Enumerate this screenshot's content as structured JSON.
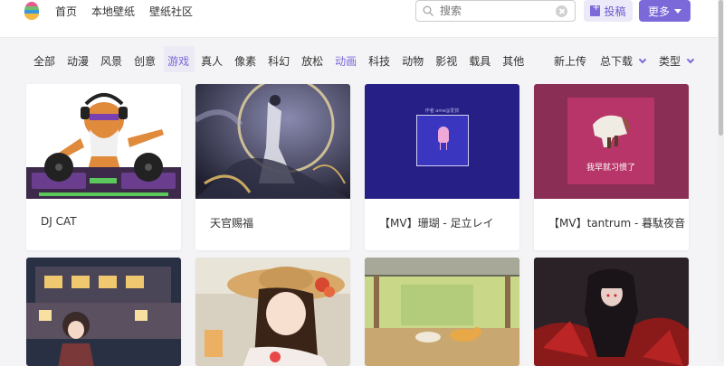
{
  "nav": {
    "home": "首页",
    "local": "本地壁纸",
    "community": "壁纸社区"
  },
  "search": {
    "placeholder": "搜索",
    "value": ""
  },
  "buttons": {
    "post": "投稿",
    "more": "更多"
  },
  "categories": [
    "全部",
    "动漫",
    "风景",
    "创意",
    "游戏",
    "真人",
    "像素",
    "科幻",
    "放松",
    "动画",
    "科技",
    "动物",
    "影视",
    "载具",
    "其他"
  ],
  "hovered_category": "游戏",
  "selected_category": "动画",
  "sorts": {
    "new": "新上传",
    "downloads": "总下载",
    "type": "类型"
  },
  "cards": [
    {
      "title": "DJ CAT"
    },
    {
      "title": "天官赐福"
    },
    {
      "title": "【MV】珊瑚 - 足立レイ",
      "thumb_caption": "作者 ame@爱抓"
    },
    {
      "title": "【MV】tantrum - 暮駄夜音",
      "thumb_caption": "我早就习惯了"
    },
    {
      "title": ""
    },
    {
      "title": ""
    },
    {
      "title": ""
    },
    {
      "title": ""
    }
  ],
  "colors": {
    "accent": "#7b68d9",
    "accent_light": "#ece9f8",
    "card_bg": "#ffffff"
  }
}
